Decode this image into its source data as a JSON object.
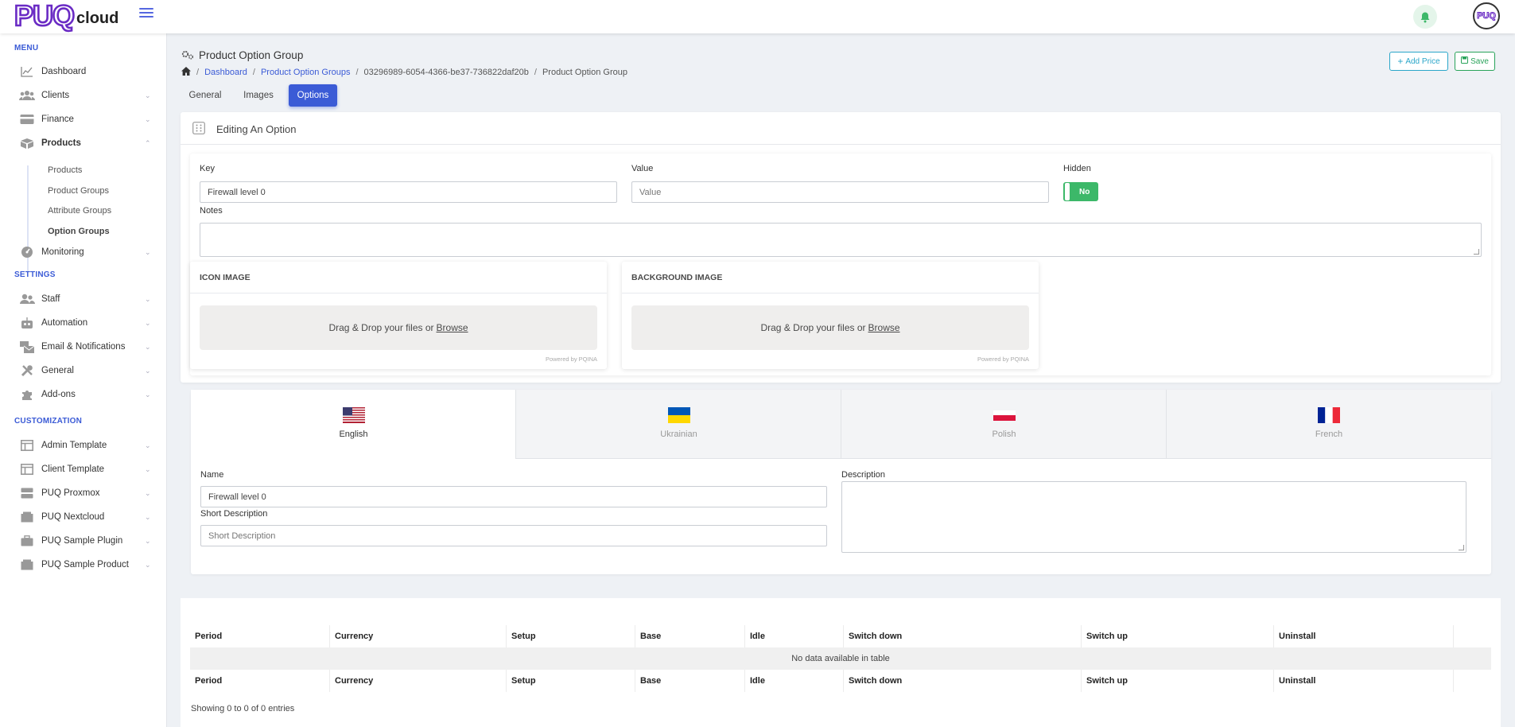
{
  "brand": {
    "logo_main": "PUQ",
    "logo_sub": "cloud",
    "avatar_text": "PUQ"
  },
  "sidebar": {
    "menu_title": "MENU",
    "settings_title": "SETTINGS",
    "customization_title": "CUSTOMIZATION",
    "items": {
      "dashboard": "Dashboard",
      "clients": "Clients",
      "finance": "Finance",
      "products": "Products",
      "monitoring": "Monitoring",
      "staff": "Staff",
      "automation": "Automation",
      "email": "Email & Notifications",
      "general": "General",
      "addons": "Add-ons",
      "admin_template": "Admin Template",
      "client_template": "Client Template",
      "puq_proxmox": "PUQ Proxmox",
      "puq_nextcloud": "PUQ Nextcloud",
      "puq_sample_plugin": "PUQ Sample Plugin",
      "puq_sample_product": "PUQ Sample Product"
    },
    "products_sub": [
      "Products",
      "Product Groups",
      "Attribute Groups",
      "Option Groups"
    ]
  },
  "header": {
    "title": "Product Option Group",
    "breadcrumb": [
      "Dashboard",
      "Product Option Groups",
      "03296989-6054-4366-be37-736822daf20b",
      "Product Option Group"
    ],
    "add_price": "Add Price",
    "save": "Save"
  },
  "tabs": [
    "General",
    "Images",
    "Options"
  ],
  "editing": {
    "title": "Editing An Option",
    "key_label": "Key",
    "key_value": "Firewall level 0",
    "value_label": "Value",
    "value_placeholder": "Value",
    "hidden_label": "Hidden",
    "hidden_value": "No",
    "notes_label": "Notes",
    "icon_image": "ICON IMAGE",
    "background_image": "BACKGROUND IMAGE",
    "drop_text": "Drag & Drop your files or",
    "browse": "Browse",
    "powered": "Powered by PQINA"
  },
  "languages": [
    "English",
    "Ukrainian",
    "Polish",
    "French"
  ],
  "lang_form": {
    "name_label": "Name",
    "name_value": "Firewall level 0",
    "short_desc_label": "Short Description",
    "short_desc_placeholder": "Short Description",
    "desc_label": "Description"
  },
  "table": {
    "columns": [
      "Period",
      "Currency",
      "Setup",
      "Base",
      "Idle",
      "Switch down",
      "Switch up",
      "Uninstall"
    ],
    "empty": "No data available in table",
    "info": "Showing 0 to 0 of 0 entries"
  },
  "colors": {
    "accent": "#3b5bd6",
    "success": "#3cb869",
    "brand": "#6a2bc4"
  }
}
